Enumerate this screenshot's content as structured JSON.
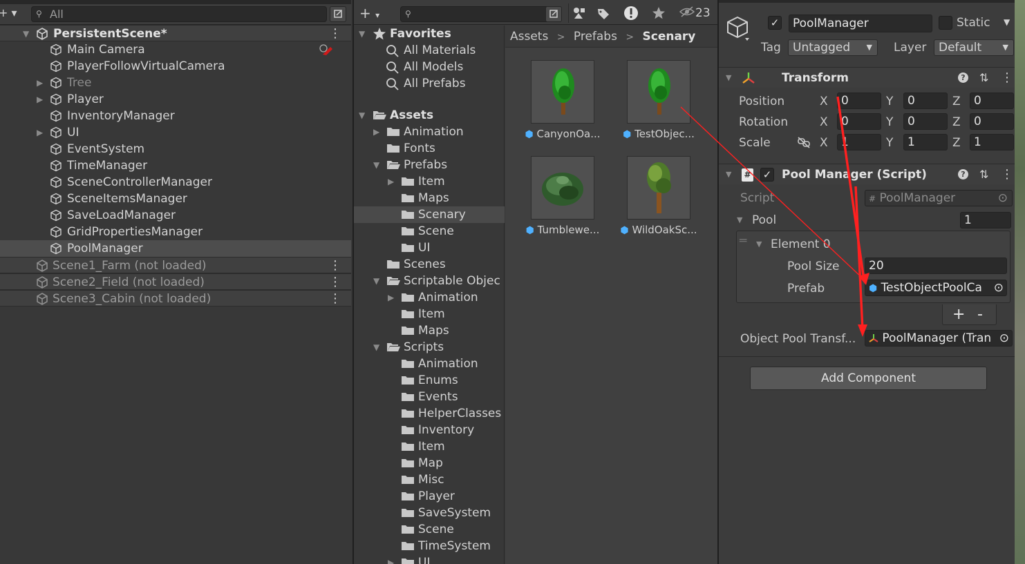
{
  "hierarchy": {
    "search_placeholder": "All",
    "add_label": "+ ▾",
    "scene": "PersistentScene*",
    "items": [
      {
        "label": "Main Camera",
        "icon": "cube-icon"
      },
      {
        "label": "PlayerFollowVirtualCamera",
        "icon": "cube-icon"
      },
      {
        "label": "Tree",
        "icon": "cube-icon"
      },
      {
        "label": "Player",
        "icon": "cube-icon"
      },
      {
        "label": "InventoryManager",
        "icon": "cube-icon"
      },
      {
        "label": "UI",
        "icon": "cube-icon"
      },
      {
        "label": "EventSystem",
        "icon": "cube-icon"
      },
      {
        "label": "TimeManager",
        "icon": "cube-icon"
      },
      {
        "label": "SceneControllerManager",
        "icon": "cube-icon"
      },
      {
        "label": "SceneItemsManager",
        "icon": "cube-icon"
      },
      {
        "label": "SaveLoadManager",
        "icon": "cube-icon"
      },
      {
        "label": "GridPropertiesManager",
        "icon": "cube-icon"
      },
      {
        "label": "PoolManager",
        "icon": "cube-icon"
      }
    ],
    "unloaded_scenes": [
      "Scene1_Farm (not loaded)",
      "Scene2_Field (not loaded)",
      "Scene3_Cabin (not loaded)"
    ]
  },
  "project": {
    "hidden_count": "23",
    "favorites": {
      "label": "Favorites",
      "items": [
        "All Materials",
        "All Models",
        "All Prefabs"
      ]
    },
    "assets_label": "Assets",
    "tree": [
      "Animation",
      "Fonts",
      "Prefabs",
      "Item",
      "Maps",
      "Scenary",
      "Scene",
      "UI",
      "Scenes",
      "Scriptable Objec",
      "Animation",
      "Item",
      "Maps",
      "Scripts",
      "Animation",
      "Enums",
      "Events",
      "HelperClasses",
      "Inventory",
      "Item",
      "Map",
      "Misc",
      "Player",
      "SaveSystem",
      "Scene",
      "TimeSystem",
      "UI"
    ],
    "breadcrumb": [
      "Assets",
      "Prefabs",
      "Scenary"
    ],
    "assets": [
      "CanyonOa...",
      "TestObjec...",
      "Tumblewe...",
      "WildOakSc..."
    ]
  },
  "inspector": {
    "object_name": "PoolManager",
    "static_label": "Static",
    "tag_label": "Tag",
    "tag_value": "Untagged",
    "layer_label": "Layer",
    "layer_value": "Default",
    "transform": {
      "title": "Transform",
      "position_label": "Position",
      "rotation_label": "Rotation",
      "scale_label": "Scale",
      "position": [
        "0",
        "0",
        "0"
      ],
      "rotation": [
        "0",
        "0",
        "0"
      ],
      "scale": [
        "1",
        "1",
        "1"
      ]
    },
    "script_component": {
      "title": "Pool Manager (Script)",
      "script_label": "Script",
      "script_value": "PoolManager",
      "pool_label": "Pool",
      "pool_size": "1",
      "element_label": "Element 0",
      "pool_size_label": "Pool Size",
      "pool_size_value": "20",
      "prefab_label": "Prefab",
      "prefab_value": "TestObjectPoolCa",
      "transform_label": "Object Pool Transf...",
      "transform_value": "PoolManager (Tran"
    },
    "add_component": "Add Component"
  },
  "colors": {
    "annotation_arrow": "#ff2020",
    "selection": "#4d4d4d"
  }
}
